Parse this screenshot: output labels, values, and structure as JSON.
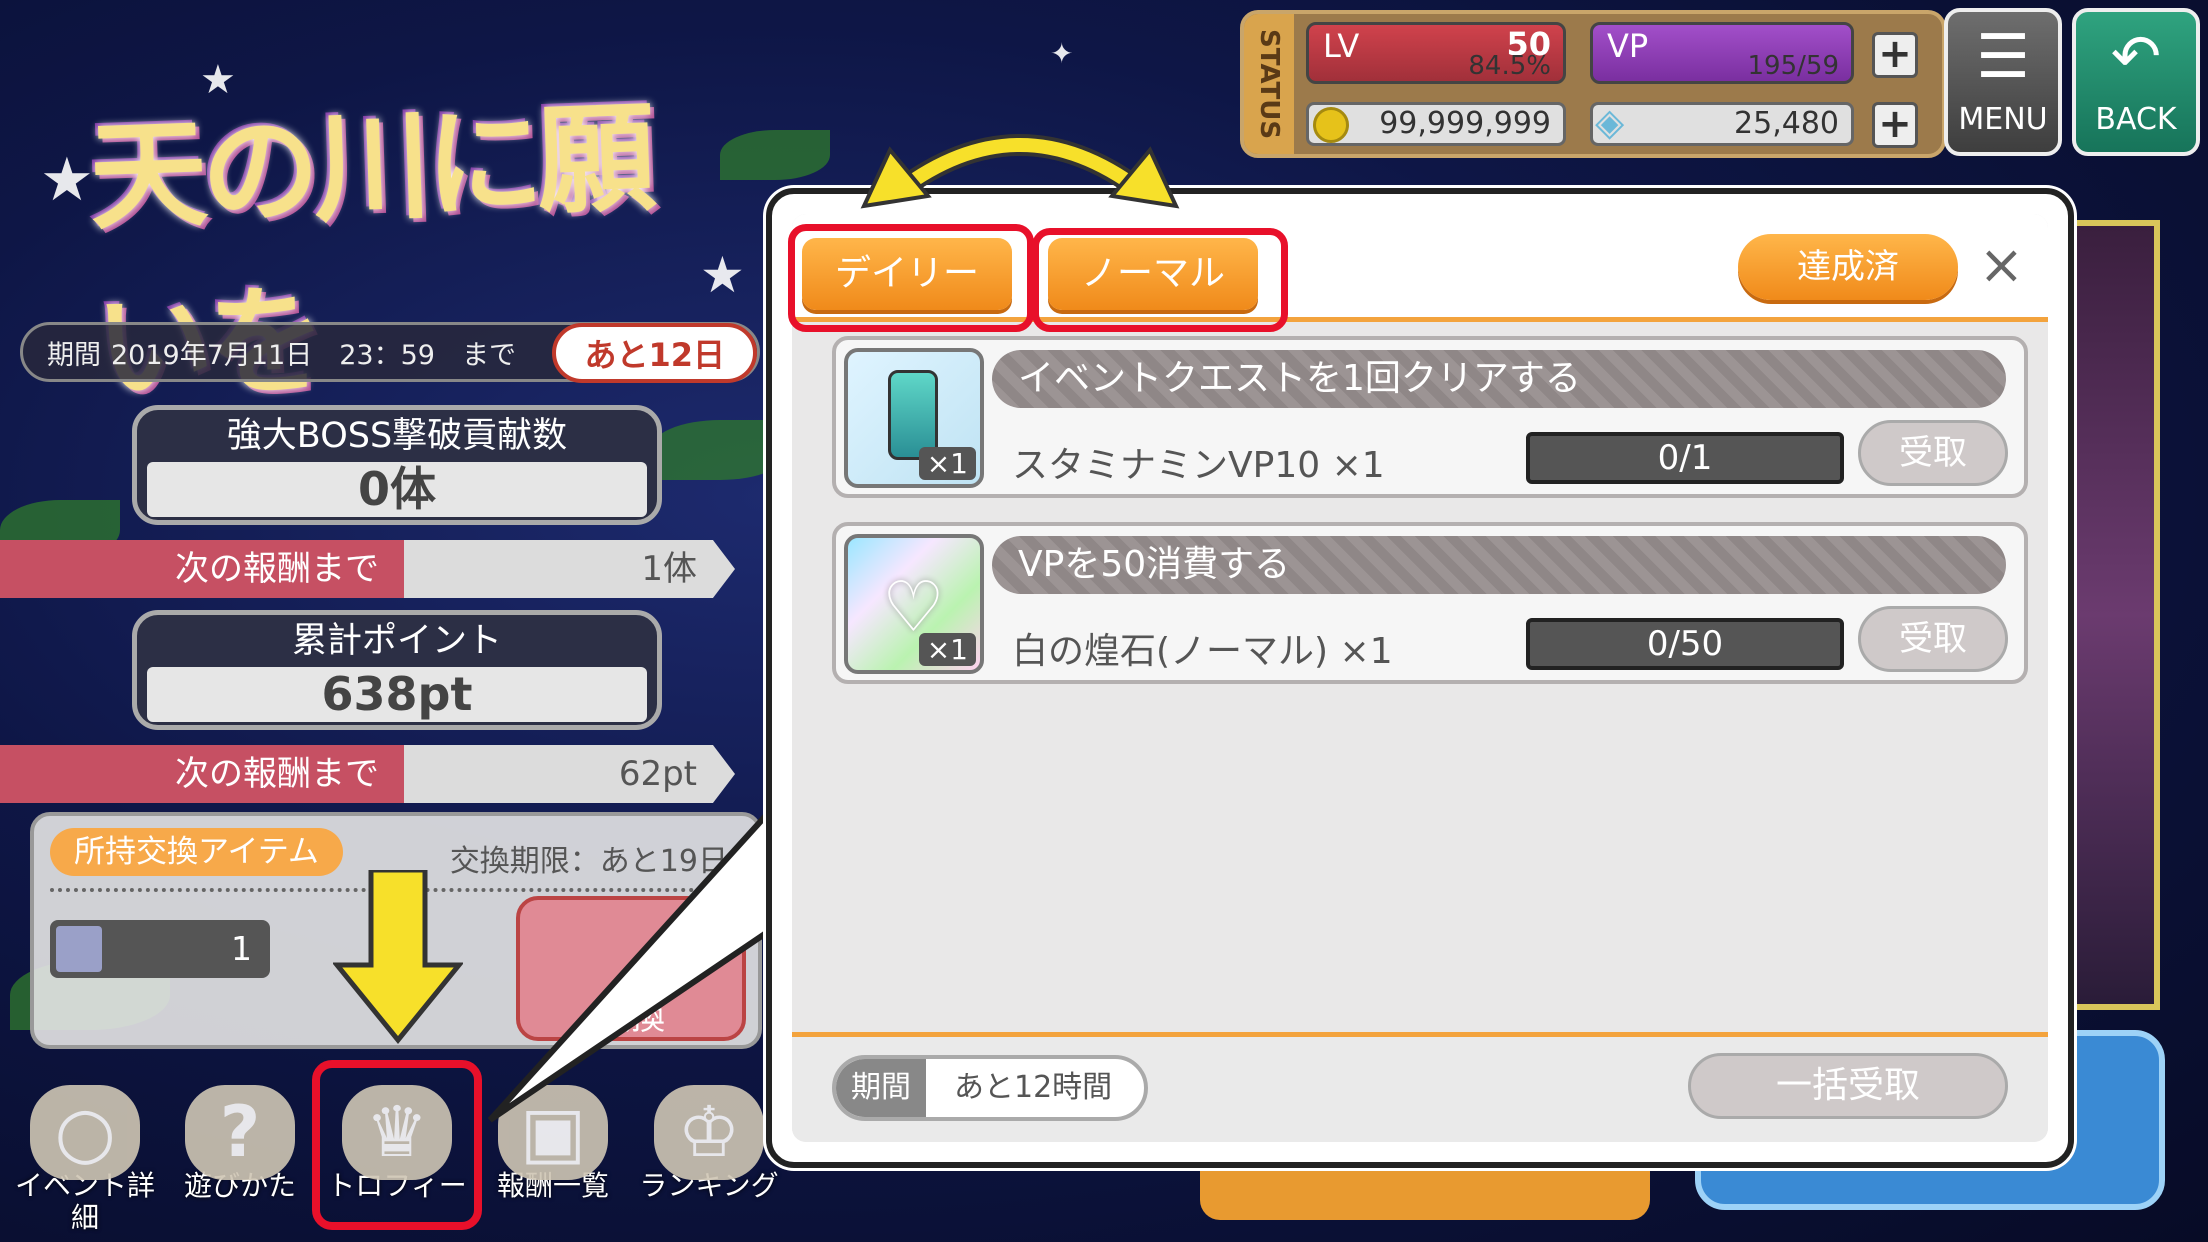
{
  "event": {
    "logo_text": "天の川に願いを",
    "period_label": "期間",
    "period_date": "2019年7月11日　23：59　まで",
    "remaining": "あと12日",
    "boss": {
      "label": "強大BOSS撃破貢献数",
      "value": "0体"
    },
    "next_reward_1": {
      "label": "次の報酬まで",
      "value": "1体"
    },
    "points": {
      "label": "累計ポイント",
      "value": "638pt"
    },
    "next_reward_2": {
      "label": "次の報酬まで",
      "value": "62pt"
    },
    "exchange": {
      "tag": "所持交換アイテム",
      "limit": "交換期限：あと19日",
      "count": "1",
      "button": "交換"
    }
  },
  "status": {
    "side": "STATUS",
    "lv_label": "LV",
    "lv_value": "50",
    "lv_pct": "84.5%",
    "vp_label": "VP",
    "vp_value": "195/59",
    "coins": "99,999,999",
    "gems": "25,480",
    "plus": "+",
    "menu_label": "MENU",
    "back_label": "BACK"
  },
  "nav": [
    {
      "label": "イベント詳細",
      "icon": "magnifier-icon"
    },
    {
      "label": "遊びかた",
      "icon": "question-icon"
    },
    {
      "label": "トロフィー",
      "icon": "trophy-icon"
    },
    {
      "label": "報酬一覧",
      "icon": "chest-icon"
    },
    {
      "label": "ランキング",
      "icon": "crown-icon"
    }
  ],
  "modal": {
    "tab_daily": "デイリー",
    "tab_normal": "ノーマル",
    "achieved": "達成済",
    "close": "×",
    "missions": [
      {
        "title": "イベントクエストを1回クリアする",
        "reward": "スタミナミンVP10 ×1",
        "progress": "0/1",
        "qty": "×1",
        "button": "受取",
        "icon": "stamina-potion-icon"
      },
      {
        "title": "VPを50消費する",
        "reward": "白の煌石(ノーマル) ×1",
        "progress": "0/50",
        "qty": "×1",
        "button": "受取",
        "icon": "white-stone-icon"
      }
    ],
    "period_label": "期間",
    "period_value": "あと12時間",
    "bulk_button": "一括受取"
  },
  "colors": {
    "accent": "#f08a1a",
    "highlight": "#e8102a",
    "arrow": "#f7e02a"
  }
}
